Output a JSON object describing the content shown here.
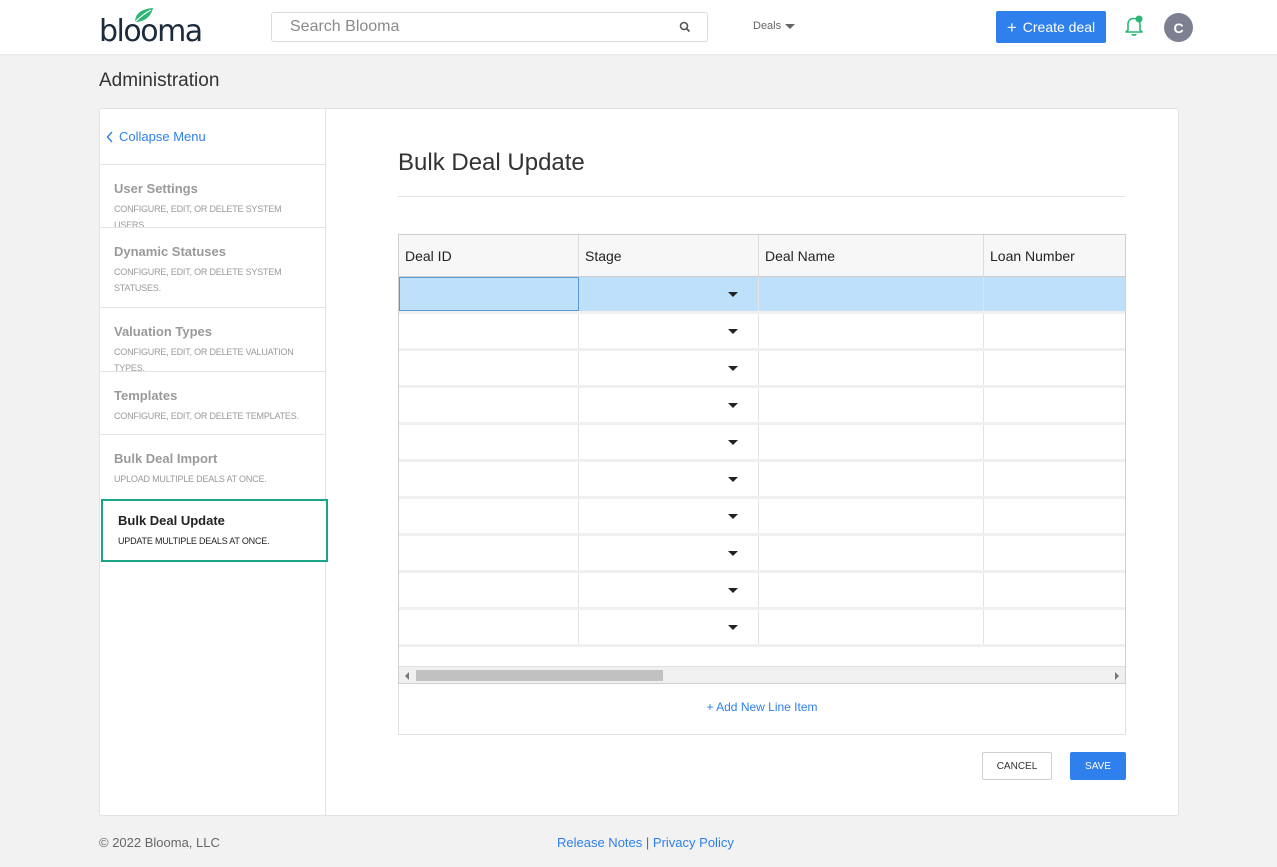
{
  "header": {
    "logo_text": "blooma",
    "search_placeholder": "Search Blooma",
    "deals_menu_label": "Deals",
    "create_button_label": "Create deal",
    "avatar_initial": "C"
  },
  "page": {
    "title": "Administration"
  },
  "sidebar": {
    "collapse_label": "Collapse Menu",
    "items": [
      {
        "title": "User Settings",
        "description": "CONFIGURE, EDIT, OR DELETE SYSTEM USERS."
      },
      {
        "title": "Dynamic Statuses",
        "description": "CONFIGURE, EDIT, OR DELETE SYSTEM STATUSES."
      },
      {
        "title": "Valuation Types",
        "description": "CONFIGURE, EDIT, OR DELETE VALUATION TYPES."
      },
      {
        "title": "Templates",
        "description": "CONFIGURE, EDIT, OR DELETE TEMPLATES."
      },
      {
        "title": "Bulk Deal Import",
        "description": "UPLOAD MULTIPLE DEALS AT ONCE."
      },
      {
        "title": "Bulk Deal Update",
        "description": "UPDATE MULTIPLE DEALS AT ONCE.",
        "active": true
      }
    ]
  },
  "main": {
    "title": "Bulk Deal Update",
    "grid": {
      "columns": [
        "Deal ID",
        "Stage",
        "Deal Name",
        "Loan Number"
      ],
      "row_count": 10,
      "selected_row": 1
    },
    "add_line_label": "+ Add New Line Item",
    "cancel_label": "CANCEL",
    "save_label": "SAVE"
  },
  "footer": {
    "copyright": "© 2022 Blooma, LLC",
    "release_notes": "Release Notes",
    "separator": "|",
    "privacy_policy": "Privacy Policy"
  },
  "colors": {
    "accent": "#2f80ed",
    "active_border": "#1ba588",
    "selected_row": "#bfe0fb",
    "bell": "#2bb673",
    "avatar": "#7d8090"
  }
}
